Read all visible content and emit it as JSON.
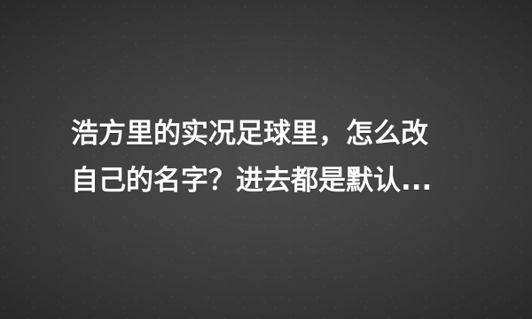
{
  "question": {
    "line1": "浩方里的实况足球里，怎么改",
    "line2": "自己的名字？进去都是默认..."
  }
}
